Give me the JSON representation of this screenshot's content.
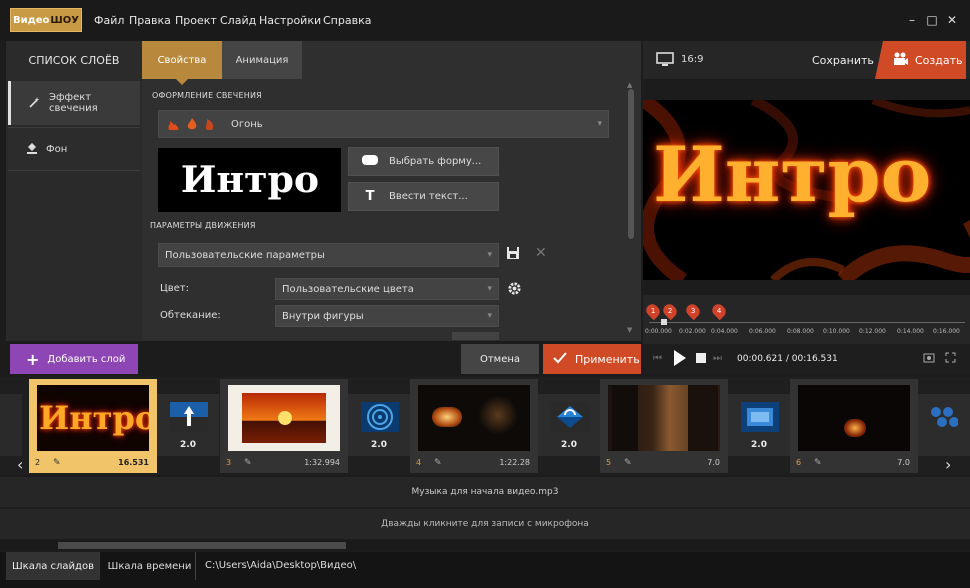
{
  "app": {
    "logo_part1": "Видео",
    "logo_part2": "ШОУ"
  },
  "menu": [
    "Файл",
    "Правка",
    "Проект",
    "Слайд",
    "Настройки",
    "Справка"
  ],
  "window_controls": {
    "minimize": "–",
    "maximize": "□",
    "close": "✕"
  },
  "layers_panel": {
    "title": "СПИСОК СЛОЁВ",
    "items": [
      {
        "label": "Эффект свечения",
        "icon": "wand-icon"
      },
      {
        "label": "Фон",
        "icon": "paint-bucket-icon"
      }
    ]
  },
  "tabs": {
    "properties": "Свойства",
    "animation": "Анимация"
  },
  "glow": {
    "section": "ОФОРМЛЕНИЕ СВЕЧЕНИЯ",
    "preset": "Огонь",
    "thumb_text": "Интро",
    "choose_shape": "Выбрать форму...",
    "enter_text": "Ввести текст..."
  },
  "motion": {
    "section": "ПАРАМЕТРЫ ДВИЖЕНИЯ",
    "preset": "Пользовательские параметры",
    "color_label": "Цвет:",
    "color_value": "Пользовательские цвета",
    "flow_label": "Обтекание:",
    "flow_value": "Внутри фигуры"
  },
  "preview": {
    "aspect": "16:9",
    "save": "Сохранить",
    "create": "Создать",
    "text": "Интро",
    "time_current": "00:00.621",
    "time_sep": " / ",
    "time_total": "00:16.531",
    "markers": [
      "1",
      "2",
      "3",
      "4"
    ],
    "ticks": [
      "0:00.000",
      "0:02.000",
      "0:04.000",
      "0:06.000",
      "0:08.000",
      "0:10.000",
      "0:12.000",
      "0:14.000",
      "0:16.000"
    ]
  },
  "actions": {
    "add_layer": "Добавить слой",
    "cancel": "Отмена",
    "apply": "Применить"
  },
  "slides": [
    {
      "num": "2",
      "duration": "16.531",
      "title": "Интро"
    },
    {
      "num": "3",
      "duration": "1:32.994"
    },
    {
      "num": "4",
      "duration": "1:22.28"
    },
    {
      "num": "5",
      "duration": "7.0"
    },
    {
      "num": "6",
      "duration": "7.0"
    }
  ],
  "transitions": [
    "2.0",
    "2.0",
    "2.0",
    "2.0"
  ],
  "audio": {
    "music": "Музыка для начала видео.mp3",
    "mic": "Дважды кликните для записи с микрофона"
  },
  "bottom": {
    "slides_tab": "Шкала слайдов",
    "timeline_tab": "Шкала времени",
    "path": "C:\\Users\\Aida\\Desktop\\Видео\\"
  },
  "colors": {
    "accent_gold": "#b8893d",
    "accent_red": "#d14a26",
    "accent_purple": "#8d46b4"
  }
}
